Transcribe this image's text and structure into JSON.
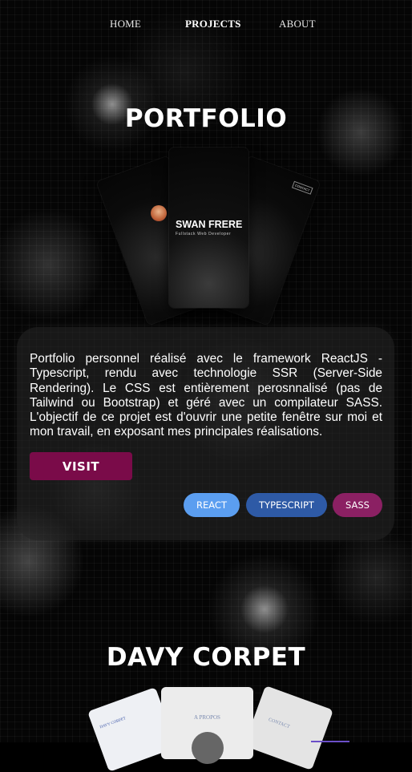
{
  "nav": {
    "items": [
      {
        "label": "HOME"
      },
      {
        "label": "PROJECTS"
      },
      {
        "label": "ABOUT"
      }
    ]
  },
  "projects": [
    {
      "title": "PORTFOLIO",
      "mockup": {
        "name": "SWAN FRERE",
        "subtitle": "Fullstack Web Developer",
        "contact_tag": "CONTACT"
      },
      "description": "Portfolio personnel réalisé avec le framework ReactJS - Typescript, rendu avec technologie SSR (Server-Side Rendering). Le CSS est entièrement perosnnalisé (pas de Tailwind ou Bootstrap) et géré avec un compilateur SASS. L'objectif de ce projet est d'ouvrir une petite fenêtre sur moi et mon travail, en exposant mes principales réalisations.",
      "visit_label": "VISIT",
      "tags": [
        {
          "label": "REACT",
          "color": "#5b9ef0"
        },
        {
          "label": "TYPESCRIPT",
          "color": "#2e5aa6"
        },
        {
          "label": "SASS",
          "color": "#8b2063"
        }
      ]
    },
    {
      "title": "DAVY CORPET",
      "mockup": {
        "left_label": "DAVY CORPET",
        "center_label": "A PROPOS",
        "right_label": "CONTACT"
      }
    }
  ],
  "colors": {
    "background": "#050505",
    "visit_button": "#7a0b49"
  }
}
